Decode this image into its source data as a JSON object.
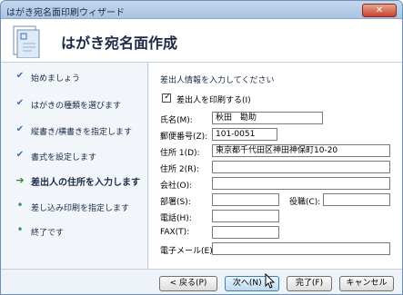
{
  "window": {
    "title": "はがき宛名面印刷ウィザード",
    "close_glyph": "✕"
  },
  "header": {
    "title": "はがき宛名面作成"
  },
  "sidebar": {
    "steps": [
      {
        "label": "始めましょう",
        "mark": "✔",
        "state": "done"
      },
      {
        "label": "はがきの種類を選びます",
        "mark": "✔",
        "state": "done"
      },
      {
        "label": "縦書き/横書きを指定します",
        "mark": "✔",
        "state": "done"
      },
      {
        "label": "書式を設定します",
        "mark": "✔",
        "state": "done"
      },
      {
        "label": "差出人の住所を入力します",
        "mark": "➔",
        "state": "current"
      },
      {
        "label": "差し込み印刷を指定します",
        "mark": "•",
        "state": "todo"
      },
      {
        "label": "終了です",
        "mark": "•",
        "state": "todo"
      }
    ]
  },
  "main": {
    "section_title": "差出人情報を入力してください",
    "print_sender": {
      "label": "差出人を印刷する(I)",
      "checked": true,
      "check_glyph": "✓"
    },
    "fields": {
      "name": {
        "label": "氏名(M):",
        "value": "秋田　勘助"
      },
      "postal": {
        "label": "郵便番号(Z):",
        "value": "101-0051"
      },
      "address1": {
        "label": "住所 1(D):",
        "value": "東京都千代田区神田神保町10-20"
      },
      "address2": {
        "label": "住所 2(R):",
        "value": ""
      },
      "company": {
        "label": "会社(O):",
        "value": ""
      },
      "department": {
        "label": "部署(S):",
        "value": ""
      },
      "title": {
        "label": "役職(C):",
        "value": ""
      },
      "phone": {
        "label": "電話(H):",
        "value": ""
      },
      "fax": {
        "label": "FAX(T):",
        "value": ""
      },
      "email": {
        "label": "電子メール(E):",
        "value": ""
      }
    }
  },
  "footer": {
    "back": "< 戻る(P)",
    "next": "次へ(N) >",
    "finish": "完了(F)",
    "cancel": "キャンセル"
  },
  "colors": {
    "accent": "#3b6fb6",
    "current_step": "#2e8b2e",
    "close": "#c7432a"
  }
}
